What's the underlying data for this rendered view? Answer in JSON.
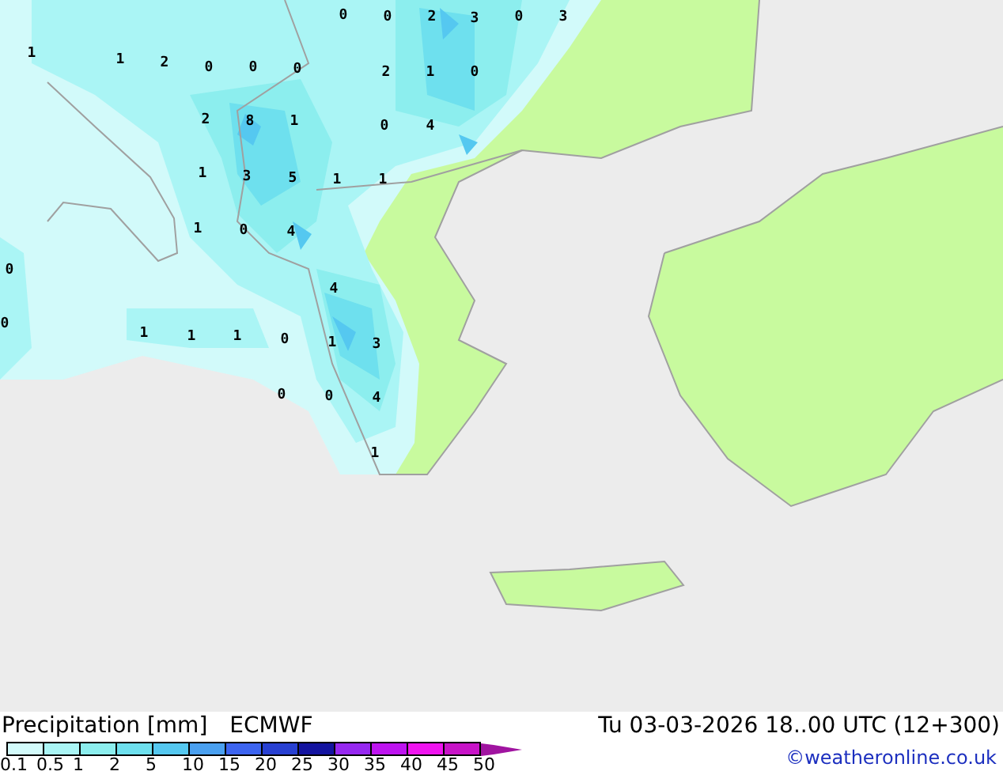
{
  "map": {
    "labels": [
      {
        "text": "1"
      },
      {
        "text": "1"
      },
      {
        "text": "2"
      },
      {
        "text": "0"
      },
      {
        "text": "0"
      },
      {
        "text": "0"
      },
      {
        "text": "0"
      },
      {
        "text": "0"
      },
      {
        "text": "2"
      },
      {
        "text": "3"
      },
      {
        "text": "0"
      },
      {
        "text": "3"
      },
      {
        "text": "2"
      },
      {
        "text": "1"
      },
      {
        "text": "0"
      },
      {
        "text": "2"
      },
      {
        "text": "8"
      },
      {
        "text": "1"
      },
      {
        "text": "0"
      },
      {
        "text": "4"
      },
      {
        "text": "1"
      },
      {
        "text": "3"
      },
      {
        "text": "5"
      },
      {
        "text": "1"
      },
      {
        "text": "1"
      },
      {
        "text": "1"
      },
      {
        "text": "0"
      },
      {
        "text": "4"
      },
      {
        "text": "0"
      },
      {
        "text": "4"
      },
      {
        "text": "0"
      },
      {
        "text": "1"
      },
      {
        "text": "1"
      },
      {
        "text": "1"
      },
      {
        "text": "0"
      },
      {
        "text": "1"
      },
      {
        "text": "3"
      },
      {
        "text": "0"
      },
      {
        "text": "0"
      },
      {
        "text": "4"
      },
      {
        "text": "1"
      }
    ]
  },
  "legend": {
    "title": "Precipitation [mm]",
    "model": "ECMWF",
    "valid_time": "Tu 03-03-2026 18..00 UTC (12+300)",
    "credit": "©weatheronline.co.uk",
    "scale": [
      {
        "color": "#d2fafa"
      },
      {
        "color": "#aaf5f5"
      },
      {
        "color": "#8ceeee"
      },
      {
        "color": "#6ee0ee"
      },
      {
        "color": "#55c8f0"
      },
      {
        "color": "#4aa0f0"
      },
      {
        "color": "#3c64f0"
      },
      {
        "color": "#2840d2"
      },
      {
        "color": "#1414a0"
      },
      {
        "color": "#9628f0"
      },
      {
        "color": "#be14f0"
      },
      {
        "color": "#f014f0"
      },
      {
        "color": "#c814c8"
      }
    ],
    "ticks": [
      "0.1",
      "0.5",
      "1",
      "2",
      "5",
      "10",
      "15",
      "20",
      "25",
      "30",
      "35",
      "40",
      "45",
      "50"
    ]
  }
}
